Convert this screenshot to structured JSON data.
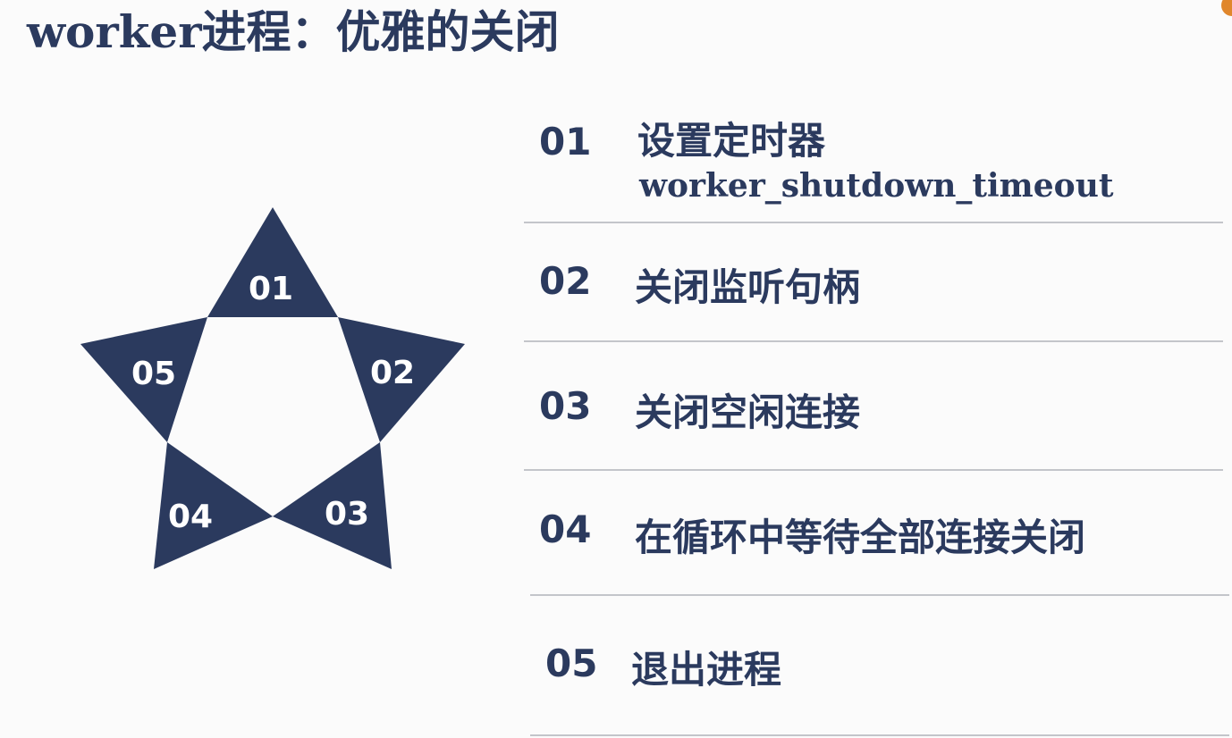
{
  "title": "worker进程：优雅的关闭",
  "colors": {
    "accent": "#2b3a5e",
    "divider": "#c3c5ca",
    "background": "#fbfbfb"
  },
  "star": {
    "labels": [
      "01",
      "02",
      "03",
      "04",
      "05"
    ]
  },
  "items": [
    {
      "number": "01",
      "label": "设置定时器",
      "sub": "worker_shutdown_timeout"
    },
    {
      "number": "02",
      "label": "关闭监听句柄"
    },
    {
      "number": "03",
      "label": "关闭空闲连接"
    },
    {
      "number": "04",
      "label": "在循环中等待全部连接关闭"
    },
    {
      "number": "05",
      "label": "退出进程"
    }
  ]
}
